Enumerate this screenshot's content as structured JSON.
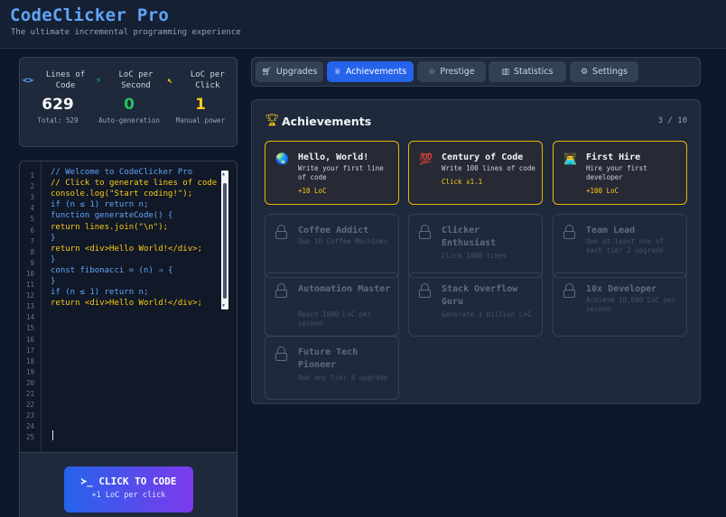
{
  "app": {
    "title": "CodeClicker Pro",
    "subtitle": "The ultimate incremental programming experience"
  },
  "stats": [
    {
      "icon": "code-brackets-icon",
      "glyph": "<>",
      "label": "Lines of Code",
      "value": "629",
      "sub": "Total: 529",
      "color": "#60a5fa",
      "value_color": "#f8fafc"
    },
    {
      "icon": "lightning-icon",
      "glyph": "⚡",
      "label": "LoC per Second",
      "value": "0",
      "sub": "Auto-generation",
      "color": "#22c55e",
      "value_color": "#22c55e"
    },
    {
      "icon": "cursor-icon",
      "glyph": "↖",
      "label": "LoC per Click",
      "value": "1",
      "sub": "Manual power",
      "color": "#facc15",
      "value_color": "#facc15"
    }
  ],
  "editor": {
    "line_numbers": [
      "1",
      "2",
      "3",
      "4",
      "5",
      "6",
      "7",
      "8",
      "9",
      "10",
      "11",
      "12",
      "13",
      "14",
      "15",
      "16",
      "17",
      "18",
      "19",
      "20",
      "21",
      "22",
      "23",
      "24",
      "25"
    ],
    "lines": [
      {
        "text": "// Welcome to CodeClicker Pro",
        "color": "#60a5fa"
      },
      {
        "text": "// Click to generate lines of code",
        "color": "#facc15"
      },
      {
        "text": "console.log(\"Start coding!\");",
        "color": "#facc15"
      },
      {
        "text": "if (n ≤ 1) return n;",
        "color": "#60a5fa"
      },
      {
        "text": "function generateCode() {",
        "color": "#60a5fa"
      },
      {
        "text": "return lines.join(\"\\n\");",
        "color": "#facc15"
      },
      {
        "text": "}",
        "color": "#60a5fa"
      },
      {
        "text": "return <div>Hello World!</div>;",
        "color": "#facc15"
      },
      {
        "text": "}",
        "color": "#60a5fa"
      },
      {
        "text": "const fibonacci = (n) ⇒ {",
        "color": "#60a5fa"
      },
      {
        "text": "}",
        "color": "#60a5fa"
      },
      {
        "text": "if (n ≤ 1) return n;",
        "color": "#60a5fa"
      },
      {
        "text": "return <div>Hello World!</div>;",
        "color": "#facc15"
      }
    ]
  },
  "click_button": {
    "label": "≻_ CLICK TO CODE",
    "sub": "+1 LoC per click"
  },
  "tabs": [
    {
      "id": "upgrades",
      "label": "Upgrades",
      "icon": "cart-icon",
      "glyph": "🛒︎",
      "active": false
    },
    {
      "id": "achievements",
      "label": "Achievements",
      "icon": "trophy-icon",
      "glyph": "♕",
      "active": true
    },
    {
      "id": "prestige",
      "label": "Prestige",
      "icon": "star-icon",
      "glyph": "☆",
      "active": false
    },
    {
      "id": "statistics",
      "label": "Statistics",
      "icon": "bar-chart-icon",
      "glyph": "▥",
      "active": false
    },
    {
      "id": "settings",
      "label": "Settings",
      "icon": "gear-icon",
      "glyph": "⚙",
      "active": false
    }
  ],
  "achievements": {
    "title": "Achievements",
    "count": "3 / 10",
    "items": [
      {
        "title": "Hello, World!",
        "desc": "Write your first line of code",
        "reward": "+10 LoC",
        "unlocked": true,
        "icon": "globe-icon",
        "glyph": "🌏"
      },
      {
        "title": "Century of Code",
        "desc": "Write 100 lines of code",
        "reward": "Click x1.1",
        "unlocked": true,
        "icon": "hundred-points-icon",
        "glyph": "💯"
      },
      {
        "title": "First Hire",
        "desc": "Hire your first developer",
        "reward": "+100 LoC",
        "unlocked": true,
        "icon": "developer-icon",
        "glyph": "👨‍💻"
      },
      {
        "title": "Coffee Addict",
        "desc": "Own 10 Coffee Machines",
        "unlocked": false
      },
      {
        "title": "Clicker Enthusiast",
        "desc": "Click 1000 times",
        "unlocked": false
      },
      {
        "title": "Team Lead",
        "desc": "Own at least one of each tier 2 upgrade",
        "unlocked": false
      },
      {
        "title": "Automation Master",
        "desc": "Reach 1000 LoC per second",
        "unlocked": false
      },
      {
        "title": "Stack Overflow Guru",
        "desc": "Generate 1 million LoC",
        "unlocked": false
      },
      {
        "title": "10x Developer",
        "desc": "Achieve 10,000 LoC per second",
        "unlocked": false
      },
      {
        "title": "Future Tech Pioneer",
        "desc": "Own any tier 4 upgrade",
        "unlocked": false
      }
    ]
  }
}
